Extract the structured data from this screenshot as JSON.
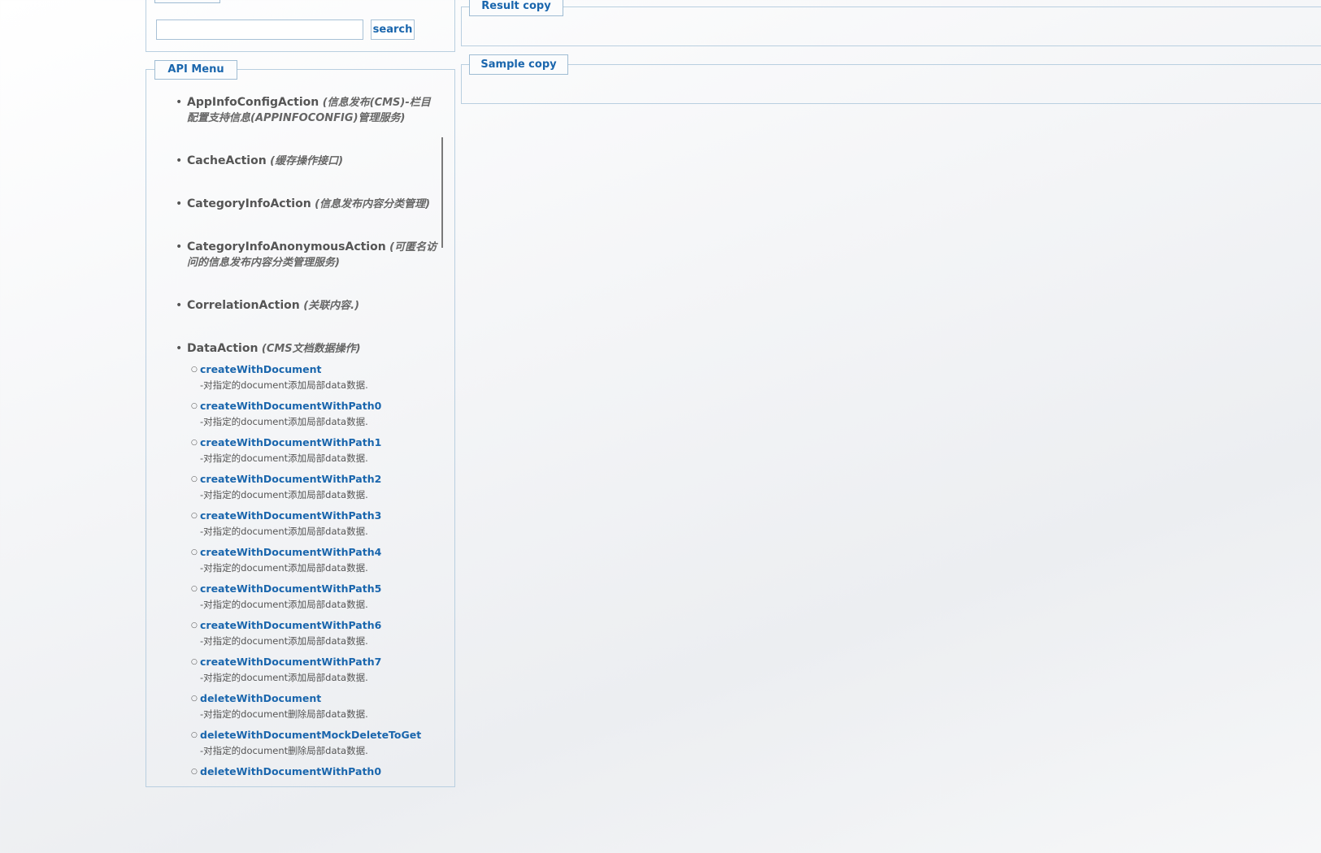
{
  "search": {
    "input_value": "",
    "input_placeholder": "",
    "button_label": "search"
  },
  "api_menu": {
    "title": "API Menu",
    "actions": [
      {
        "name": "AppInfoConfigAction",
        "description": "(信息发布(CMS)-栏目配置支持信息(APPINFOCONFIG)管理服务)"
      },
      {
        "name": "CacheAction",
        "description": "(缓存操作接口)"
      },
      {
        "name": "CategoryInfoAction",
        "description": "(信息发布内容分类管理)"
      },
      {
        "name": "CategoryInfoAnonymousAction",
        "description": "(可匿名访问的信息发布内容分类管理服务)"
      },
      {
        "name": "CorrelationAction",
        "description": "(关联内容.)"
      },
      {
        "name": "DataAction",
        "description": "(CMS文档数据操作)",
        "methods": [
          {
            "name": "createWithDocument",
            "description": "-对指定的document添加局部data数据."
          },
          {
            "name": "createWithDocumentWithPath0",
            "description": "-对指定的document添加局部data数据."
          },
          {
            "name": "createWithDocumentWithPath1",
            "description": "-对指定的document添加局部data数据."
          },
          {
            "name": "createWithDocumentWithPath2",
            "description": "-对指定的document添加局部data数据."
          },
          {
            "name": "createWithDocumentWithPath3",
            "description": "-对指定的document添加局部data数据."
          },
          {
            "name": "createWithDocumentWithPath4",
            "description": "-对指定的document添加局部data数据."
          },
          {
            "name": "createWithDocumentWithPath5",
            "description": "-对指定的document添加局部data数据."
          },
          {
            "name": "createWithDocumentWithPath6",
            "description": "-对指定的document添加局部data数据."
          },
          {
            "name": "createWithDocumentWithPath7",
            "description": "-对指定的document添加局部data数据."
          },
          {
            "name": "deleteWithDocument",
            "description": "-对指定的document删除局部data数据."
          },
          {
            "name": "deleteWithDocumentMockDeleteToGet",
            "description": "-对指定的document删除局部data数据."
          },
          {
            "name": "deleteWithDocumentWithPath0",
            "description": ""
          }
        ]
      }
    ]
  },
  "result_copy": {
    "title": "Result copy"
  },
  "sample_copy": {
    "title": "Sample copy"
  },
  "colors": {
    "accent": "#1a66ad",
    "border": "#b9cfe0",
    "text": "#555555"
  }
}
